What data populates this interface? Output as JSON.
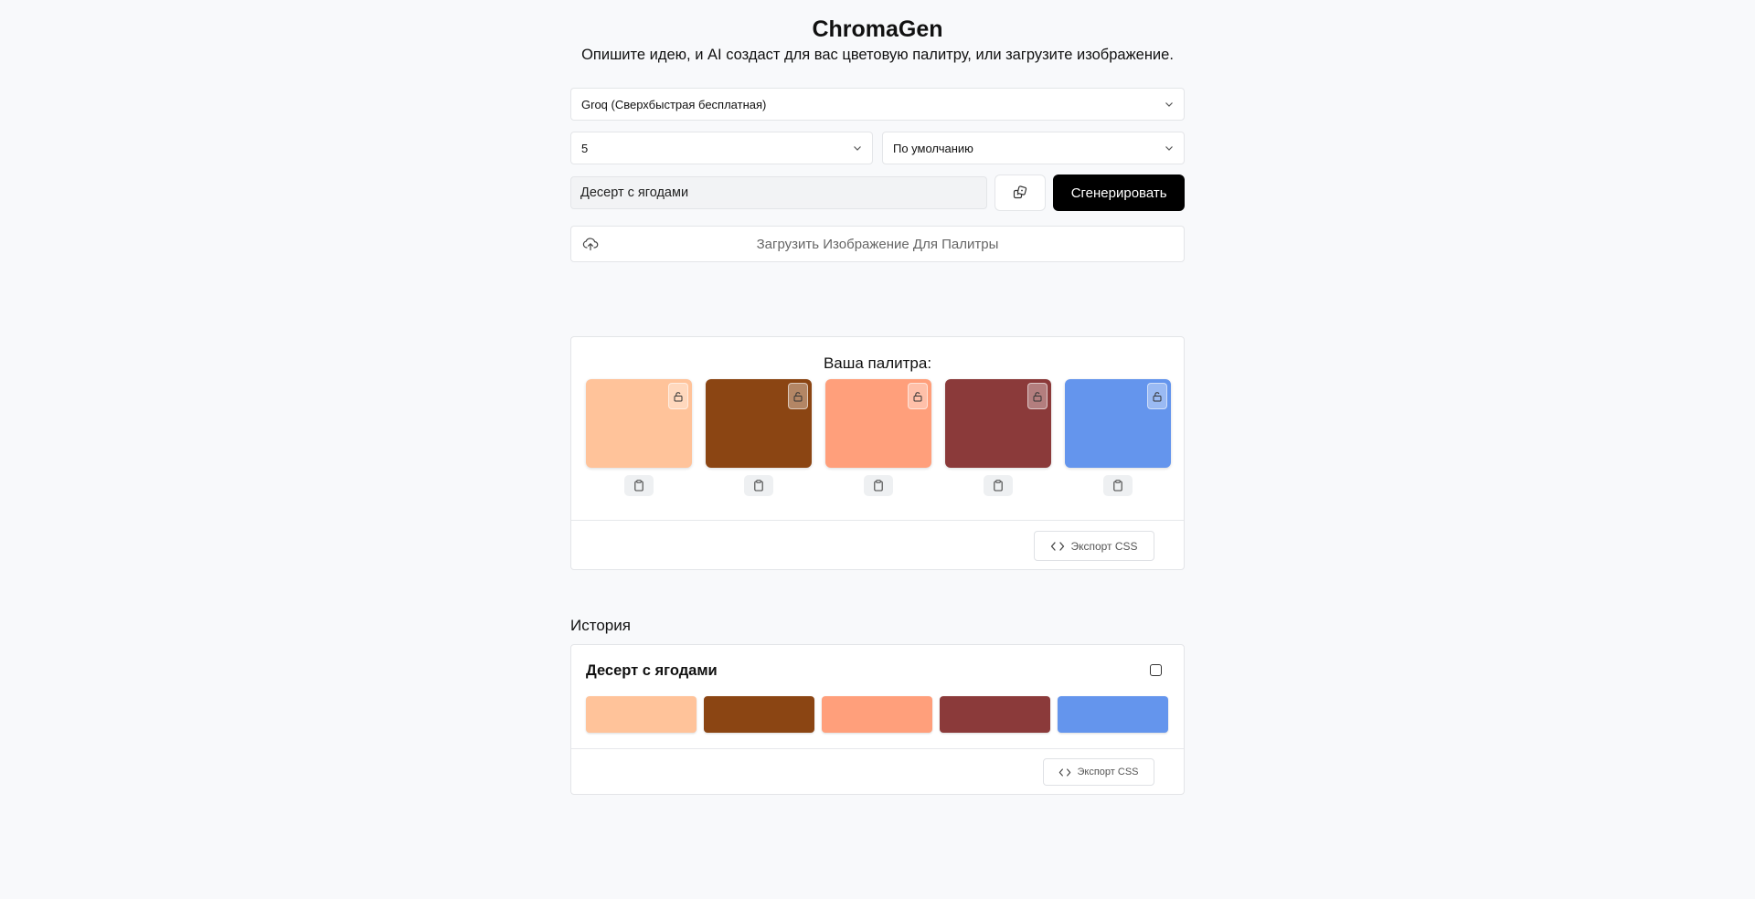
{
  "app": {
    "title": "ChromaGen",
    "subtitle": "Опишите идею, и AI создаст для вас цветовую палитру, или загрузите изображение."
  },
  "controls": {
    "model_select": "Groq (Сверхбыстрая бесплатная)",
    "count_select": "5",
    "mode_select": "По умолчанию",
    "prompt_value": "Десерт с ягодами",
    "generate_label": "Сгенерировать",
    "upload_label": "Загрузить Изображение Для Палитры"
  },
  "palette": {
    "title": "Ваша палитра:",
    "colors": [
      "#FFC39A",
      "#8B4513",
      "#FF9F7B",
      "#8B3A3A",
      "#6495ED"
    ],
    "export_label": "Экспорт CSS"
  },
  "history": {
    "title": "История",
    "items": [
      {
        "name": "Десерт с ягодами",
        "colors": [
          "#FFC39A",
          "#8B4513",
          "#FF9F7B",
          "#8B3A3A",
          "#6495ED"
        ],
        "export_label": "Экспорт CSS"
      }
    ]
  }
}
